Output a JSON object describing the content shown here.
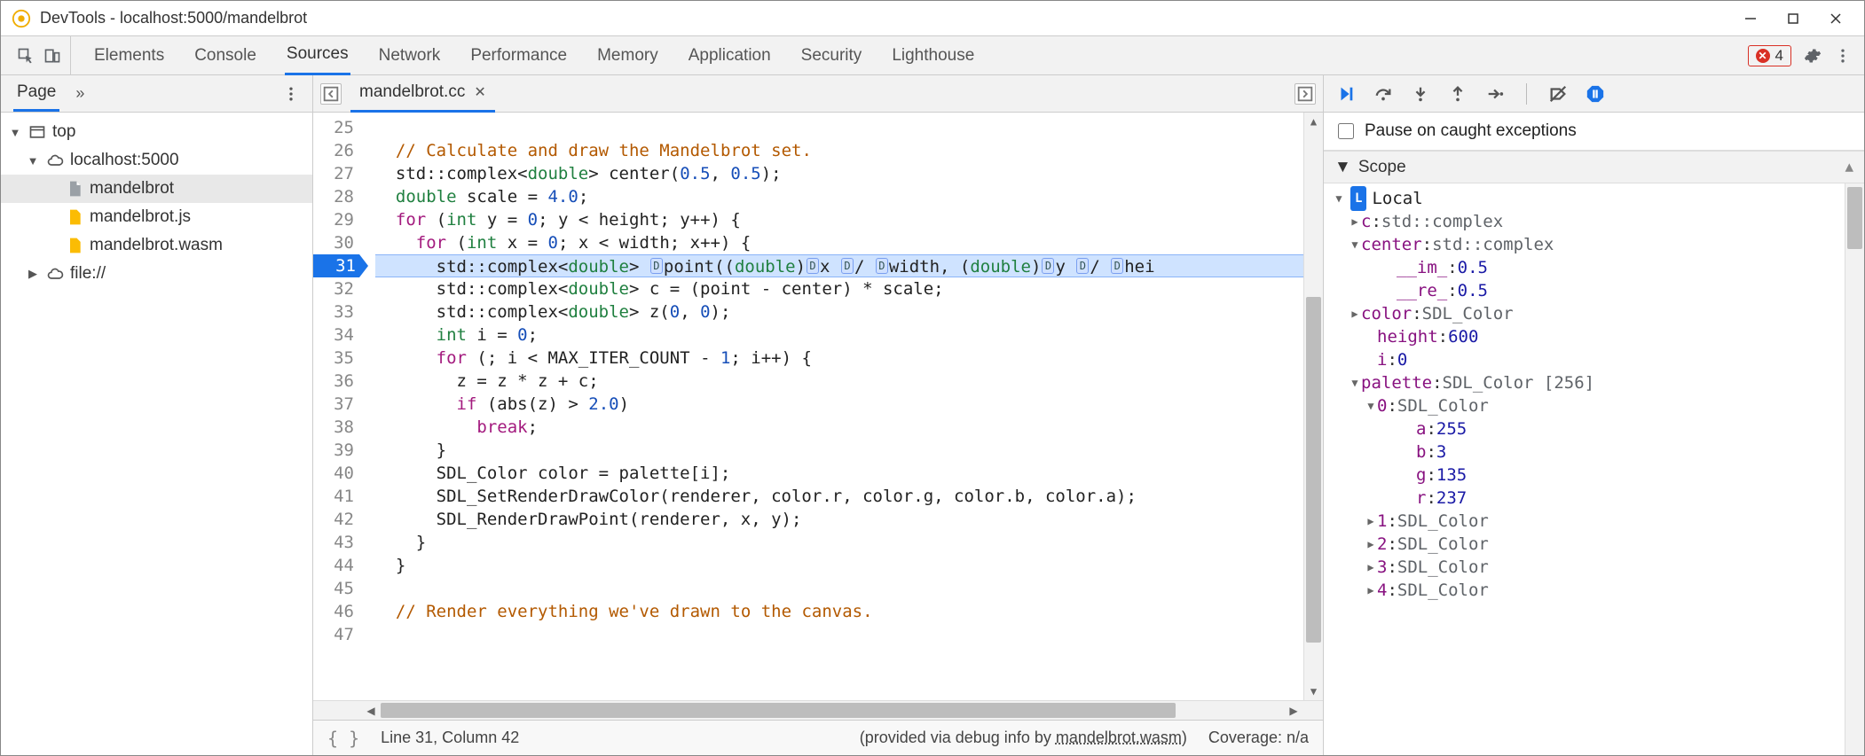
{
  "window": {
    "title": "DevTools - localhost:5000/mandelbrot"
  },
  "toolbar": {
    "tabs": [
      "Elements",
      "Console",
      "Sources",
      "Network",
      "Performance",
      "Memory",
      "Application",
      "Security",
      "Lighthouse"
    ],
    "activeTab": "Sources",
    "errorCount": "4"
  },
  "navigator": {
    "tab": "Page",
    "tree": {
      "root": "top",
      "origin": "localhost:5000",
      "files": [
        "mandelbrot",
        "mandelbrot.js",
        "mandelbrot.wasm"
      ],
      "extra": "file://"
    }
  },
  "editor": {
    "tabName": "mandelbrot.cc",
    "currentLine": 31,
    "lines": [
      {
        "n": 25,
        "html": ""
      },
      {
        "n": 26,
        "html": "  <span class='c-comment'>// Calculate and draw the Mandelbrot set.</span>"
      },
      {
        "n": 27,
        "html": "  std::complex&lt;<span class='c-type'>double</span>&gt; center(<span class='c-num'>0.5</span>, <span class='c-num'>0.5</span>);"
      },
      {
        "n": 28,
        "html": "  <span class='c-type'>double</span> scale = <span class='c-num'>4.0</span>;"
      },
      {
        "n": 29,
        "html": "  <span class='c-keyword'>for</span> (<span class='c-type'>int</span> y = <span class='c-num'>0</span>; y &lt; height; y++) {"
      },
      {
        "n": 30,
        "html": "    <span class='c-keyword'>for</span> (<span class='c-type'>int</span> x = <span class='c-num'>0</span>; x &lt; width; x++) {"
      },
      {
        "n": 31,
        "html": "      std::complex&lt;<span class='c-type'>double</span>&gt; <span class='dmark'></span>point((<span class='c-type'>double</span>)<span class='dmark'></span>x <span class='dmark'></span>/ <span class='dmark'></span>width, (<span class='c-type'>double</span>)<span class='dmark'></span>y <span class='dmark'></span>/ <span class='dmark'></span>hei"
      },
      {
        "n": 32,
        "html": "      std::complex&lt;<span class='c-type'>double</span>&gt; c = (point - center) * scale;"
      },
      {
        "n": 33,
        "html": "      std::complex&lt;<span class='c-type'>double</span>&gt; z(<span class='c-num'>0</span>, <span class='c-num'>0</span>);"
      },
      {
        "n": 34,
        "html": "      <span class='c-type'>int</span> i = <span class='c-num'>0</span>;"
      },
      {
        "n": 35,
        "html": "      <span class='c-keyword'>for</span> (; i &lt; MAX_ITER_COUNT - <span class='c-num'>1</span>; i++) {"
      },
      {
        "n": 36,
        "html": "        z = z * z + c;"
      },
      {
        "n": 37,
        "html": "        <span class='c-keyword'>if</span> (abs(z) &gt; <span class='c-num'>2.0</span>)"
      },
      {
        "n": 38,
        "html": "          <span class='c-keyword'>break</span>;"
      },
      {
        "n": 39,
        "html": "      }"
      },
      {
        "n": 40,
        "html": "      SDL_Color color = palette[i];"
      },
      {
        "n": 41,
        "html": "      SDL_SetRenderDrawColor(renderer, color.r, color.g, color.b, color.a);"
      },
      {
        "n": 42,
        "html": "      SDL_RenderDrawPoint(renderer, x, y);"
      },
      {
        "n": 43,
        "html": "    }"
      },
      {
        "n": 44,
        "html": "  }"
      },
      {
        "n": 45,
        "html": ""
      },
      {
        "n": 46,
        "html": "  <span class='c-comment'>// Render everything we've drawn to the canvas.</span>"
      },
      {
        "n": 47,
        "html": ""
      }
    ]
  },
  "status": {
    "pos": "Line 31, Column 42",
    "info_prefix": "(provided via debug info by ",
    "info_link": "mandelbrot.wasm",
    "info_suffix": ")",
    "coverage": "Coverage: n/a"
  },
  "debug": {
    "pauseOnCaught": "Pause on caught exceptions",
    "scopeHeader": "Scope",
    "localHeader": "Local",
    "rows": [
      {
        "pad": 1,
        "tw": "▶",
        "name": "c",
        "sep": ": ",
        "val": "std::complex<double>",
        "cls": "k-val-txt"
      },
      {
        "pad": 1,
        "tw": "▼",
        "name": "center",
        "sep": ": ",
        "val": "std::complex<double>",
        "cls": "k-val-txt"
      },
      {
        "pad": 3,
        "tw": "",
        "name": "__im_",
        "sep": ": ",
        "val": "0.5",
        "cls": "k-val-num"
      },
      {
        "pad": 3,
        "tw": "",
        "name": "__re_",
        "sep": ": ",
        "val": "0.5",
        "cls": "k-val-num"
      },
      {
        "pad": 1,
        "tw": "▶",
        "name": "color",
        "sep": ": ",
        "val": "SDL_Color",
        "cls": "k-val-txt"
      },
      {
        "pad": 2,
        "tw": "",
        "name": "height",
        "sep": ": ",
        "val": "600",
        "cls": "k-val-num"
      },
      {
        "pad": 2,
        "tw": "",
        "name": "i",
        "sep": ": ",
        "val": "0",
        "cls": "k-val-num"
      },
      {
        "pad": 1,
        "tw": "▼",
        "name": "palette",
        "sep": ": ",
        "val": "SDL_Color [256]",
        "cls": "k-val-txt"
      },
      {
        "pad": 2,
        "tw": "▼",
        "name": "0",
        "sep": ": ",
        "val": "SDL_Color",
        "cls": "k-val-txt"
      },
      {
        "pad": 4,
        "tw": "",
        "name": "a",
        "sep": ": ",
        "val": "255",
        "cls": "k-val-num"
      },
      {
        "pad": 4,
        "tw": "",
        "name": "b",
        "sep": ": ",
        "val": "3",
        "cls": "k-val-num"
      },
      {
        "pad": 4,
        "tw": "",
        "name": "g",
        "sep": ": ",
        "val": "135",
        "cls": "k-val-num"
      },
      {
        "pad": 4,
        "tw": "",
        "name": "r",
        "sep": ": ",
        "val": "237",
        "cls": "k-val-num"
      },
      {
        "pad": 2,
        "tw": "▶",
        "name": "1",
        "sep": ": ",
        "val": "SDL_Color",
        "cls": "k-val-txt"
      },
      {
        "pad": 2,
        "tw": "▶",
        "name": "2",
        "sep": ": ",
        "val": "SDL_Color",
        "cls": "k-val-txt"
      },
      {
        "pad": 2,
        "tw": "▶",
        "name": "3",
        "sep": ": ",
        "val": "SDL_Color",
        "cls": "k-val-txt"
      },
      {
        "pad": 2,
        "tw": "▶",
        "name": "4",
        "sep": ": ",
        "val": "SDL_Color",
        "cls": "k-val-txt"
      }
    ]
  }
}
